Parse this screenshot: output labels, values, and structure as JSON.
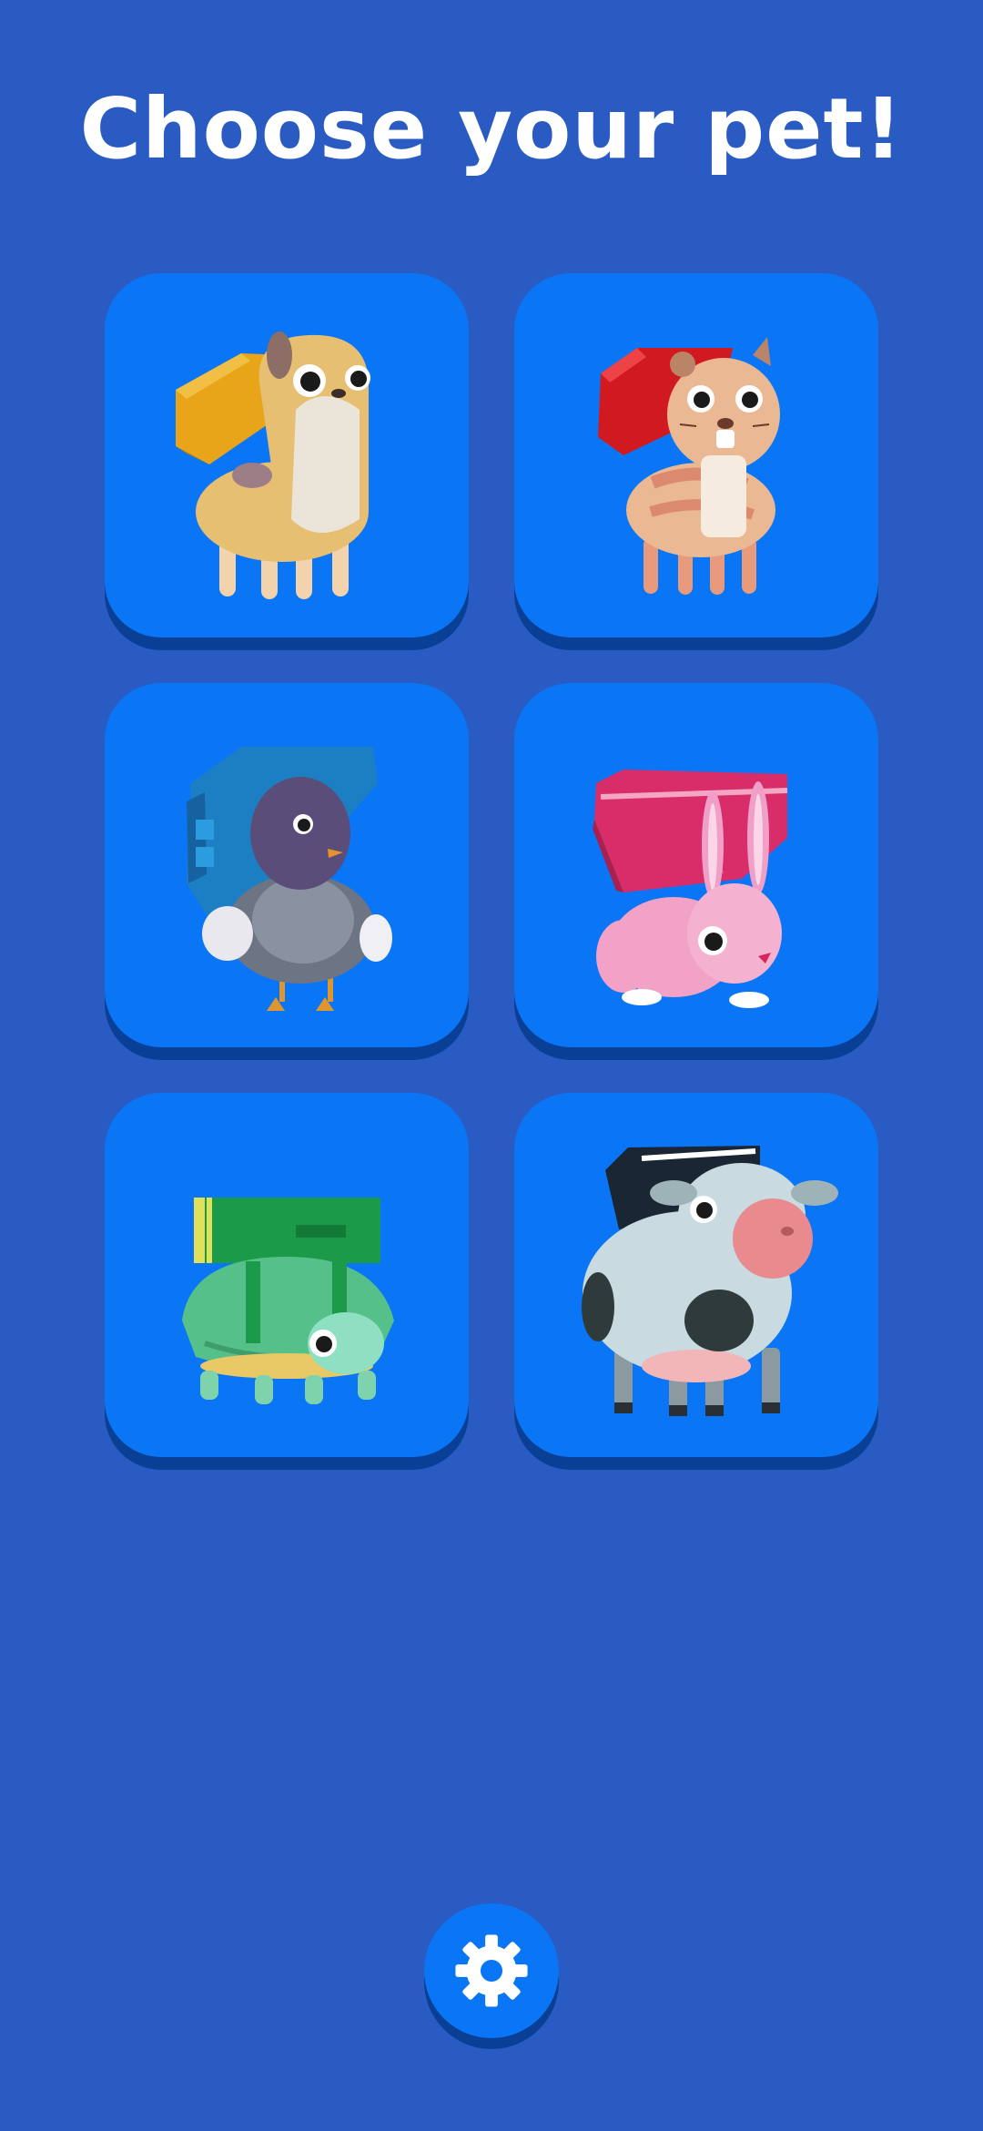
{
  "title": "Choose your pet!",
  "pets": [
    {
      "name": "dog",
      "icon": "dog-icon"
    },
    {
      "name": "hamster",
      "icon": "hamster-icon"
    },
    {
      "name": "pigeon",
      "icon": "pigeon-icon"
    },
    {
      "name": "bunny",
      "icon": "bunny-icon"
    },
    {
      "name": "turtle",
      "icon": "turtle-icon"
    },
    {
      "name": "cow",
      "icon": "cow-icon"
    }
  ],
  "settings": {
    "icon": "gear-icon"
  },
  "colors": {
    "background": "#2a5bc2",
    "card": "#0a76f5",
    "card_shadow": "#0a3f96",
    "title": "#ffffff"
  }
}
